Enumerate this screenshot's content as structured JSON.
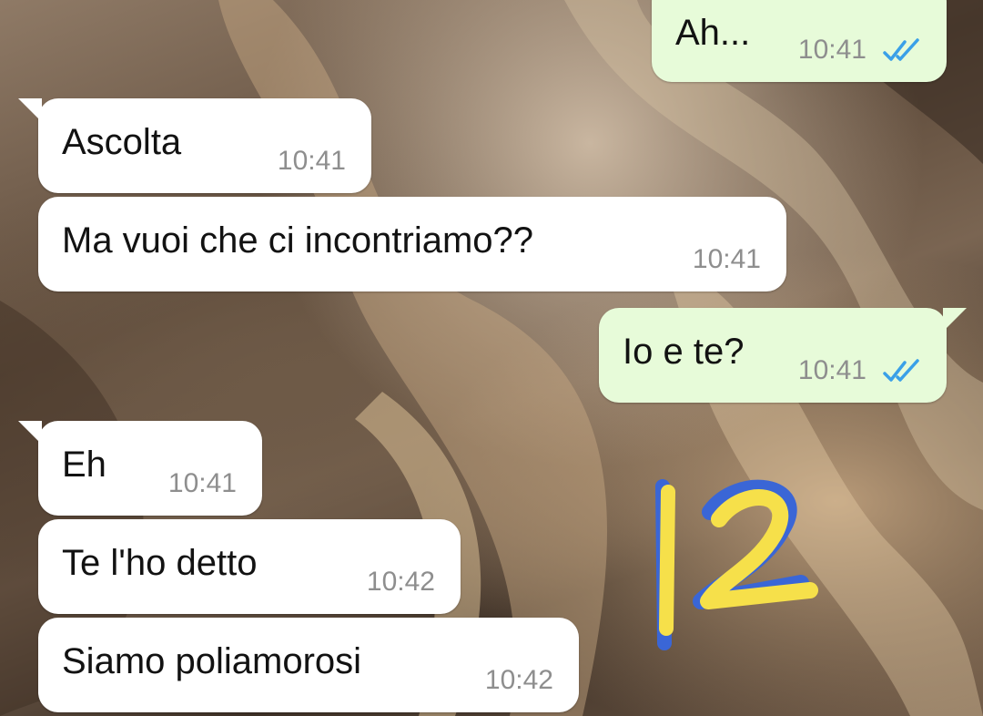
{
  "messages": [
    {
      "direction": "out",
      "text": "Ah...",
      "time": "10:41",
      "status": "read"
    },
    {
      "direction": "in",
      "text": "Ascolta",
      "time": "10:41"
    },
    {
      "direction": "in",
      "text": "Ma vuoi che ci incontriamo??",
      "time": "10:41"
    },
    {
      "direction": "out",
      "text": "Io e te?",
      "time": "10:41",
      "status": "read"
    },
    {
      "direction": "in",
      "text": "Eh",
      "time": "10:41"
    },
    {
      "direction": "in",
      "text": "Te l'ho detto",
      "time": "10:42"
    },
    {
      "direction": "in",
      "text": "Siamo poliamorosi",
      "time": "10:42"
    }
  ],
  "annotation": {
    "text": "12",
    "colors": {
      "primary": "#f6e04a",
      "shadow": "#3a66d6"
    }
  },
  "colors": {
    "incoming_bubble": "#ffffff",
    "outgoing_bubble": "#e7fbd9",
    "read_ticks": "#3aa0e8",
    "timestamp": "#8e8e8e"
  },
  "icons": {
    "read_status": "double-check-icon"
  }
}
